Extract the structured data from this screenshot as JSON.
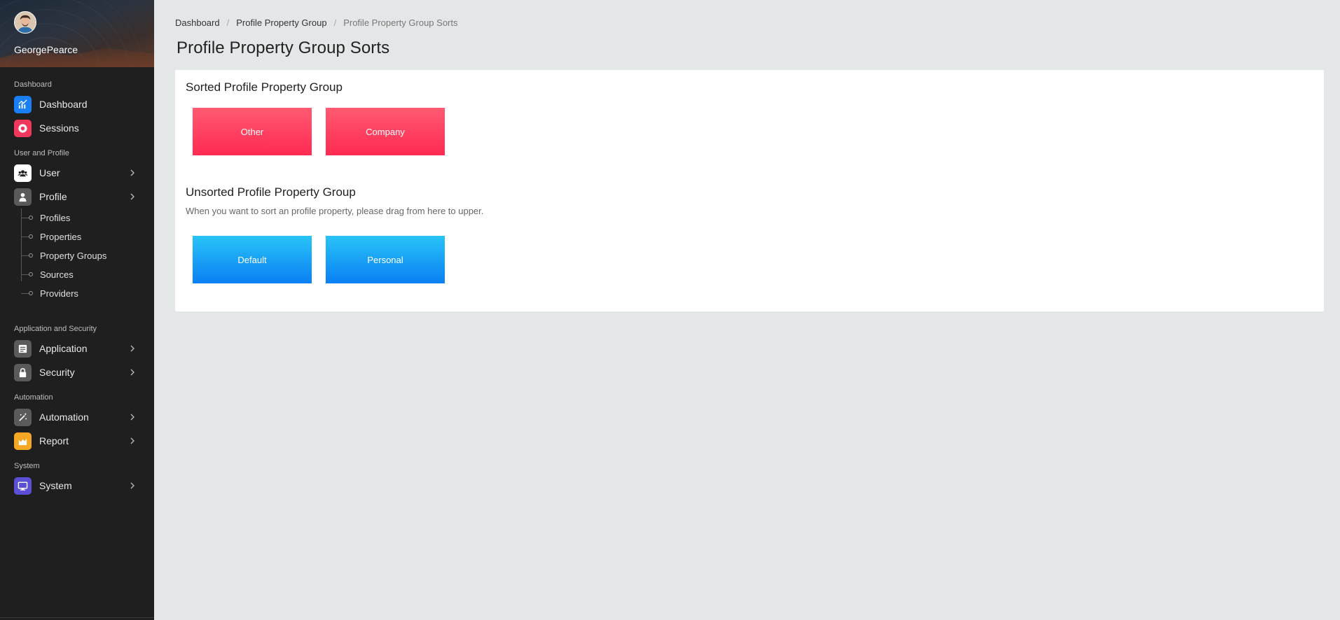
{
  "user": {
    "name": "GeorgePearce"
  },
  "sidebar": {
    "sections": [
      {
        "label": "Dashboard"
      },
      {
        "label": "User and Profile"
      },
      {
        "label": "Application and Security"
      },
      {
        "label": "Automation"
      },
      {
        "label": "System"
      }
    ],
    "items": {
      "dashboard": {
        "label": "Dashboard",
        "icon": "chart-icon",
        "color": "#1a7ff5"
      },
      "sessions": {
        "label": "Sessions",
        "icon": "record-icon",
        "color": "#f2375c"
      },
      "user": {
        "label": "User",
        "icon": "users-icon",
        "color": "#ffffff"
      },
      "profile": {
        "label": "Profile",
        "icon": "person-icon",
        "color": "#5a5a5a"
      },
      "application": {
        "label": "Application",
        "icon": "application-icon",
        "color": "#5a5a5a"
      },
      "security": {
        "label": "Security",
        "icon": "lock-icon",
        "color": "#5a5a5a"
      },
      "automation": {
        "label": "Automation",
        "icon": "magic-wand-icon",
        "color": "#5a5a5a"
      },
      "report": {
        "label": "Report",
        "icon": "area-chart-icon",
        "color": "#f5a623"
      },
      "system": {
        "label": "System",
        "icon": "monitor-icon",
        "color": "#5b4fd6"
      }
    },
    "profile_sub": [
      "Profiles",
      "Properties",
      "Property Groups",
      "Sources",
      "Providers"
    ]
  },
  "breadcrumb": [
    "Dashboard",
    "Profile Property Group",
    "Profile Property Group Sorts"
  ],
  "page_title": "Profile Property Group Sorts",
  "sorted": {
    "title": "Sorted Profile Property Group",
    "items": [
      "Other",
      "Company"
    ],
    "color": "#ff3a5c"
  },
  "unsorted": {
    "title": "Unsorted Profile Property Group",
    "hint": "When you want to sort an profile property, please drag from here to upper.",
    "items": [
      "Default",
      "Personal"
    ],
    "color": "#1a9cf5"
  }
}
